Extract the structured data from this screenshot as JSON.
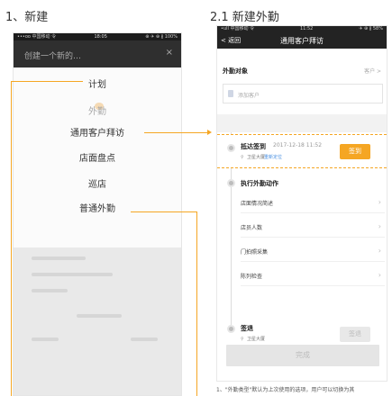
{
  "headings": {
    "left": "1、新建",
    "right": "2.1 新建外勤"
  },
  "left_phone": {
    "status": {
      "carrier": "•••oo 中国移动 令",
      "time": "18:05",
      "battery": "⊕ ✈ ⊕ ∦ 100%"
    },
    "title": "创建一个新的…",
    "close_icon": "×",
    "menu_items": [
      {
        "label": "计划",
        "faded": false
      },
      {
        "label": "外勤",
        "faded": true
      },
      {
        "label": "通用客户拜访",
        "faded": false
      },
      {
        "label": "店面盘点",
        "faded": false
      },
      {
        "label": "巡店",
        "faded": false
      },
      {
        "label": "普通外勤",
        "faded": false
      }
    ]
  },
  "right_phone": {
    "status": {
      "carrier": "•ull 中国移动 令",
      "time": "11:52",
      "battery": "✈ ⊕ ∦ 58%"
    },
    "nav": {
      "back": "< 返回",
      "title": "通用客户拜访"
    },
    "target": {
      "label": "外勤对象",
      "value": "客户 >",
      "input_placeholder": "添加客户"
    },
    "checkin": {
      "label": "抵达签到",
      "time": "2017-12-18 11:52",
      "location": "卫星大厦",
      "relocate": "重新定位",
      "button": "签到"
    },
    "actions": {
      "label": "执行外勤动作",
      "items": [
        "店面情况简述",
        "店员人数",
        "门拍照采集",
        "陈列检查"
      ]
    },
    "checkout": {
      "label": "签退",
      "location": "卫星大厦",
      "button": "签退"
    },
    "done_button": "完成"
  },
  "footnote": "1、\"外勤类型\"默认为上次使用的选项，用户可以切换为其",
  "colors": {
    "accent": "#f5a623",
    "dark_bar": "#232323"
  }
}
